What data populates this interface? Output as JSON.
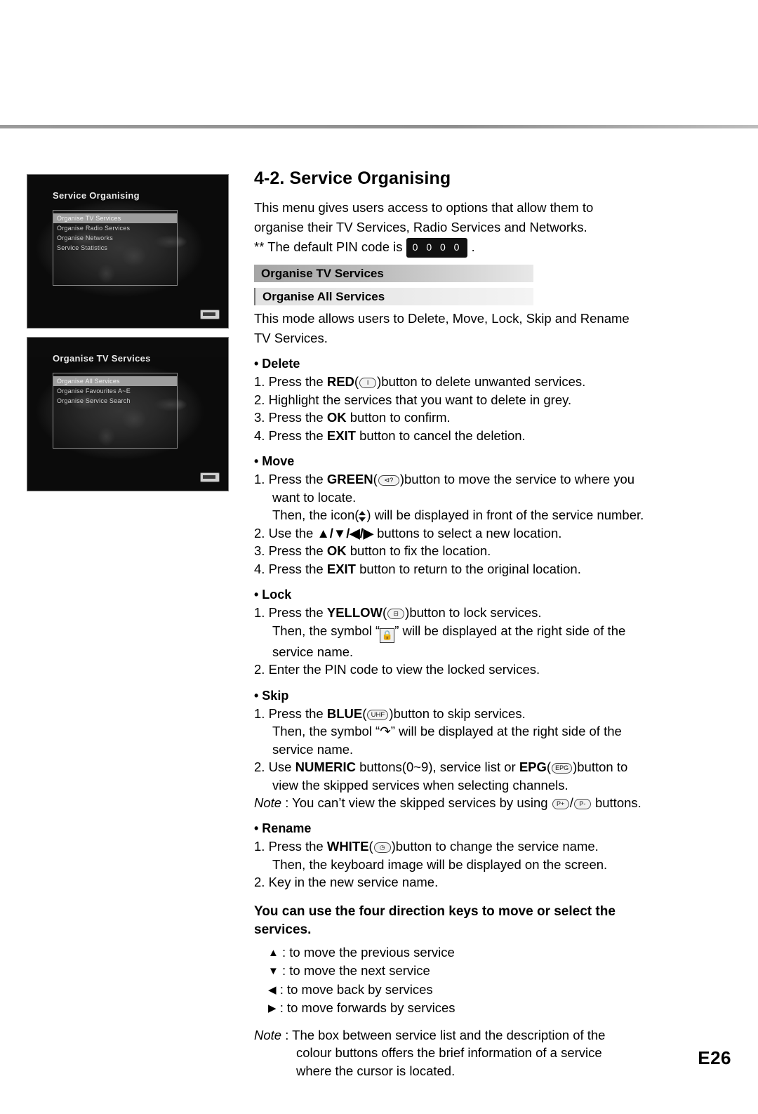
{
  "page_number": "E26",
  "screenshots": [
    {
      "title": "Service Organising",
      "menu_items": [
        {
          "label": "Organise TV Services",
          "selected": true
        },
        {
          "label": "Organise Radio Services",
          "selected": false
        },
        {
          "label": "Organise Networks",
          "selected": false
        },
        {
          "label": "Service Statistics",
          "selected": false
        }
      ]
    },
    {
      "title": "Organise TV Services",
      "menu_items": [
        {
          "label": "Organise All Services",
          "selected": true
        },
        {
          "label": "Organise Favourites A~E",
          "selected": false
        },
        {
          "label": "Organise Service Search",
          "selected": false
        }
      ]
    }
  ],
  "section": {
    "title": "4-2. Service Organising",
    "intro_line1": "This menu gives users access to options that allow them to",
    "intro_line2": "organise their TV Services, Radio Services and Networks.",
    "pin_prefix": "** The default PIN code is",
    "pin_value": "0 0 0 0",
    "pin_suffix": ".",
    "bar1": "Organise TV Services",
    "bar2": "Organise All Services",
    "mode_line1": "This mode allows users to Delete, Move, Lock, Skip and Rename",
    "mode_line2": "TV Services."
  },
  "delete": {
    "heading": "• Delete",
    "step1_a": "1. Press the ",
    "step1_b": "RED",
    "step1_key": "I",
    "step1_c": ")button to delete unwanted services.",
    "step2": "2. Highlight the services that you want to delete in grey.",
    "step3_a": "3. Press the ",
    "step3_b": "OK",
    "step3_c": " button to confirm.",
    "step4_a": "4. Press the ",
    "step4_b": "EXIT",
    "step4_c": " button to cancel the deletion."
  },
  "move": {
    "heading": "• Move",
    "step1_a": "1. Press the ",
    "step1_b": "GREEN",
    "step1_key": "⊲?",
    "step1_c": ")button to move the service to where you",
    "step1_cont": "want to locate.",
    "step1_then_a": "Then, the icon(",
    "step1_then_b": ") will be displayed in front of the service number.",
    "step2_a": "2. Use the ",
    "step2_keys": "▲/▼/◀/▶",
    "step2_b": " buttons to select a new location.",
    "step3_a": "3. Press the ",
    "step3_b": "OK",
    "step3_c": " button to fix the location.",
    "step4_a": "4. Press the ",
    "step4_b": "EXIT",
    "step4_c": " button to return to the original location."
  },
  "lock": {
    "heading": "• Lock",
    "step1_a": "1. Press the ",
    "step1_b": "YELLOW",
    "step1_key": "⊟",
    "step1_c": ")button to lock services.",
    "step1_then_a": "Then, the symbol “",
    "step1_then_sym": "lock-icon",
    "step1_then_b": "” will be displayed at the right side of the",
    "step1_cont": "service name.",
    "step2": "2. Enter the PIN code to view the locked services."
  },
  "skip": {
    "heading": "• Skip",
    "step1_a": "1. Press the ",
    "step1_b": "BLUE",
    "step1_key": "UHF",
    "step1_c": ")button to skip services.",
    "step1_then_a": "Then, the symbol “",
    "step1_then_sym": "↷",
    "step1_then_b": "” will be displayed at the right side of the",
    "step1_cont": "service name.",
    "step2_a": "2. Use ",
    "step2_b": "NUMERIC",
    "step2_c": " buttons(0~9), service list or ",
    "step2_d": "EPG",
    "step2_key": "EPG",
    "step2_e": ")button to",
    "step2_cont": "view the skipped services when selecting channels.",
    "note_a": "Note",
    "note_b": " : You can’t view the skipped services by using ",
    "note_key1": "P+",
    "note_slash": "/",
    "note_key2": "P-",
    "note_c": " buttons."
  },
  "rename": {
    "heading": "• Rename",
    "step1_a": "1. Press the ",
    "step1_b": "WHITE",
    "step1_key": "◷",
    "step1_c": ")button to change the service name.",
    "step1_then": "Then, the keyboard image will be displayed on the screen.",
    "step2": "2. Key in the new service name."
  },
  "directions": {
    "intro_line1": "You can use the four direction keys to move or select the",
    "intro_line2": "services.",
    "items": [
      {
        "glyph": "▲",
        "text": ": to move the previous service"
      },
      {
        "glyph": "▼",
        "text": ": to move the next service"
      },
      {
        "glyph": "◀",
        "text": ": to move back by services"
      },
      {
        "glyph": "▶",
        "text": ": to move forwards by services"
      }
    ]
  },
  "final_note": {
    "label": "Note",
    "line1": " : The box between service list and the description of the",
    "line2": "colour buttons offers the brief information of a service",
    "line3": "where the cursor is located."
  }
}
